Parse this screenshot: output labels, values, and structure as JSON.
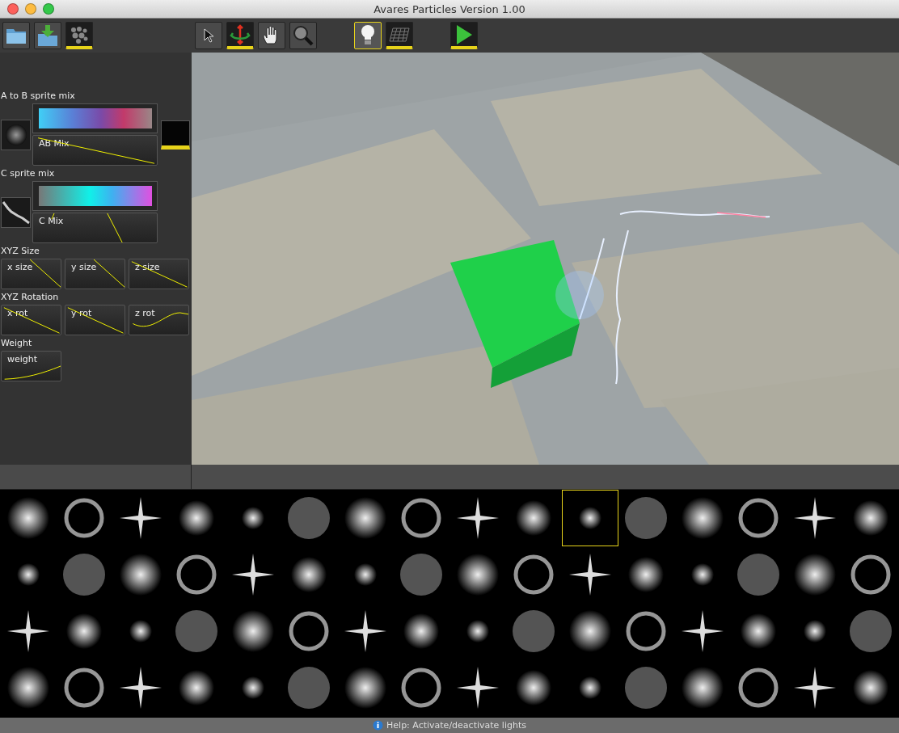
{
  "window": {
    "title": "Avares Particles Version 1.00"
  },
  "toolbar": [
    {
      "kind": "folder",
      "active": false,
      "selected": false
    },
    {
      "kind": "import",
      "active": false,
      "selected": false
    },
    {
      "kind": "particles",
      "active": true,
      "selected": false
    },
    {
      "kind": "cursor",
      "active": false,
      "selected": false
    },
    {
      "kind": "rotate",
      "active": true,
      "selected": false
    },
    {
      "kind": "hand",
      "active": false,
      "selected": false
    },
    {
      "kind": "magnifier",
      "active": false,
      "selected": false
    },
    {
      "kind": "bulb",
      "active": false,
      "selected": true
    },
    {
      "kind": "grid",
      "active": true,
      "selected": false
    },
    {
      "kind": "play",
      "active": true,
      "selected": false
    }
  ],
  "panel": {
    "sections": [
      {
        "kind": "mix",
        "label": "A to B sprite mix",
        "curve": {
          "label": "AB Mix"
        },
        "target_sprite": {
          "active": true
        }
      },
      {
        "kind": "mix",
        "label": "C sprite mix",
        "curve": {
          "label": "C Mix"
        }
      },
      {
        "kind": "curves",
        "label": "XYZ Size",
        "curves": [
          {
            "label": "x size"
          },
          {
            "label": "y size"
          },
          {
            "label": "z size"
          }
        ]
      },
      {
        "kind": "curves",
        "label": "XYZ Rotation",
        "curves": [
          {
            "label": "x rot"
          },
          {
            "label": "y rot"
          },
          {
            "label": "z rot"
          }
        ]
      },
      {
        "kind": "curves",
        "label": "Weight",
        "curves": [
          {
            "label": "weight"
          }
        ]
      }
    ]
  },
  "sprites": {
    "rows": [
      [
        {
          "selected": false
        },
        {
          "selected": false
        },
        {
          "selected": false
        },
        {
          "selected": false
        },
        {
          "selected": false
        },
        {
          "selected": false
        },
        {
          "selected": false
        },
        {
          "selected": false
        },
        {
          "selected": false
        },
        {
          "selected": false
        },
        {
          "selected": true
        },
        {
          "selected": false
        },
        {
          "selected": false
        },
        {
          "selected": false
        },
        {
          "selected": false
        },
        {
          "selected": false
        }
      ],
      [
        {
          "selected": false
        },
        {
          "selected": false
        },
        {
          "selected": false
        },
        {
          "selected": false
        },
        {
          "selected": false
        },
        {
          "selected": false
        },
        {
          "selected": false
        },
        {
          "selected": false
        },
        {
          "selected": false
        },
        {
          "selected": false
        },
        {
          "selected": false
        },
        {
          "selected": false
        },
        {
          "selected": false
        },
        {
          "selected": false
        },
        {
          "selected": false
        },
        {
          "selected": false
        }
      ],
      [
        {
          "selected": false
        },
        {
          "selected": false
        },
        {
          "selected": false
        },
        {
          "selected": false
        },
        {
          "selected": false
        },
        {
          "selected": false
        },
        {
          "selected": false
        },
        {
          "selected": false
        },
        {
          "selected": false
        },
        {
          "selected": false
        },
        {
          "selected": false
        },
        {
          "selected": false
        },
        {
          "selected": false
        },
        {
          "selected": false
        },
        {
          "selected": false
        },
        {
          "selected": false
        }
      ],
      [
        {
          "selected": false
        },
        {
          "selected": false
        },
        {
          "selected": false
        },
        {
          "selected": false
        },
        {
          "selected": false
        },
        {
          "selected": false
        },
        {
          "selected": false
        },
        {
          "selected": false
        },
        {
          "selected": false
        },
        {
          "selected": false
        },
        {
          "selected": false
        },
        {
          "selected": false
        },
        {
          "selected": false
        },
        {
          "selected": false
        },
        {
          "selected": false
        },
        {
          "selected": false
        }
      ]
    ]
  },
  "status_bar": {
    "text": "Help: Activate/deactivate lights"
  }
}
